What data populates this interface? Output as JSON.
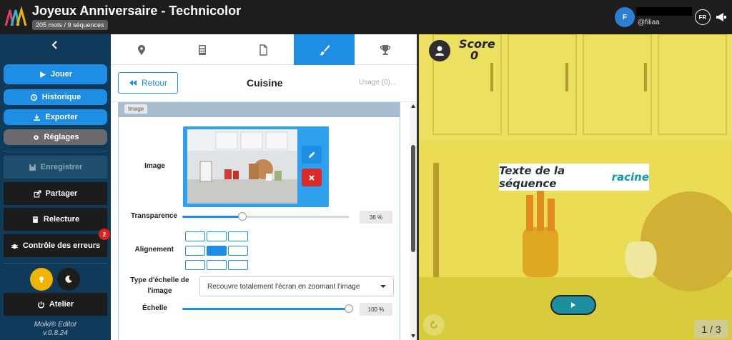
{
  "header": {
    "title": "Joyeux Anniversaire - Technicolor",
    "word_badge": "205 mots / 9 séquences",
    "avatar_initial": "F",
    "username": "@filiaa",
    "language": "FR"
  },
  "sidebar": {
    "play": "Jouer",
    "history": "Historique",
    "export": "Exporter",
    "settings": "Réglages",
    "save": "Enregistrer",
    "share": "Partager",
    "review": "Relecture",
    "error_check": "Contrôle des erreurs",
    "error_count": "2",
    "workshop": "Atelier",
    "version_line1": "Moiki® Editor",
    "version_line2": "v.0.8.24"
  },
  "editor": {
    "tabs": [
      {
        "icon": "map-marker-icon"
      },
      {
        "icon": "calculator-icon"
      },
      {
        "icon": "file-icon"
      },
      {
        "icon": "paintbrush-icon",
        "active": true
      },
      {
        "icon": "trophy-icon"
      }
    ],
    "back_label": "Retour",
    "scene_title": "Cuisine",
    "usage": "Usage (0)...",
    "section_chip": "Image",
    "image_label": "Image",
    "transparency_label": "Transparence",
    "transparency_value": "36 %",
    "transparency_pct": 0.36,
    "alignment_label": "Alignement",
    "alignment_selected": "center",
    "scale_type_label_1": "Type d'échelle de",
    "scale_type_label_2": "l'image",
    "scale_type_value": "Recouvre totalement l'écran en zoomant l'image",
    "scale_label": "Échelle",
    "scale_value": "100 %",
    "scale_pct": 1.0
  },
  "preview": {
    "score_label": "Score",
    "score_value": "0",
    "text_before": "Texte de la séquence",
    "text_highlight": "racine",
    "pager": "1 / 3"
  },
  "colors": {
    "accent": "#1d8ee3",
    "sidebar_bg": "#0f3a5a",
    "preview_bg": "#e7da4a",
    "danger": "#dc2a2a",
    "highlight_text": "#139aa4"
  }
}
